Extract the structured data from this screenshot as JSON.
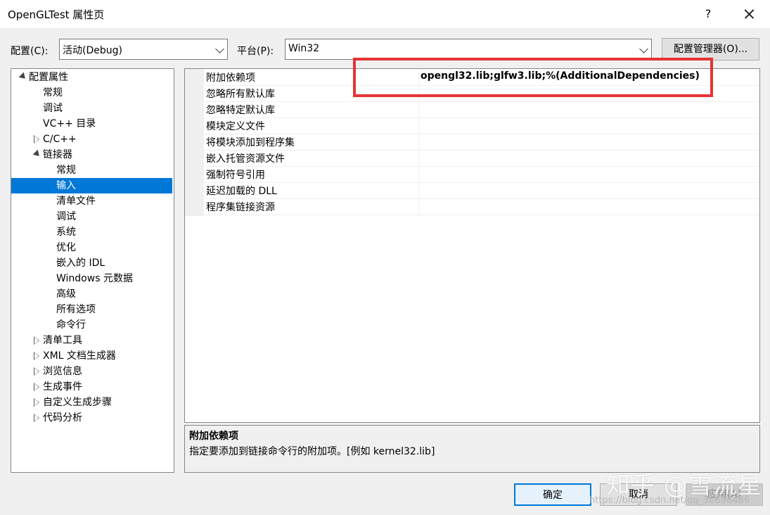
{
  "window": {
    "title": "OpenGLTest 属性页",
    "help": "?"
  },
  "config_row": {
    "config_label": "配置(C):",
    "config_value": "活动(Debug)",
    "platform_label": "平台(P):",
    "platform_value": "Win32",
    "manager_button": "配置管理器(O)..."
  },
  "tree": {
    "items": [
      {
        "label": "配置属性",
        "level": 0,
        "toggle": "expanded"
      },
      {
        "label": "常规",
        "level": 1,
        "toggle": "none"
      },
      {
        "label": "调试",
        "level": 1,
        "toggle": "none"
      },
      {
        "label": "VC++ 目录",
        "level": 1,
        "toggle": "none"
      },
      {
        "label": "C/C++",
        "level": 1,
        "toggle": "collapsed"
      },
      {
        "label": "链接器",
        "level": 1,
        "toggle": "expanded"
      },
      {
        "label": "常规",
        "level": 2,
        "toggle": "none"
      },
      {
        "label": "输入",
        "level": 2,
        "toggle": "none",
        "selected": true
      },
      {
        "label": "清单文件",
        "level": 2,
        "toggle": "none"
      },
      {
        "label": "调试",
        "level": 2,
        "toggle": "none"
      },
      {
        "label": "系统",
        "level": 2,
        "toggle": "none"
      },
      {
        "label": "优化",
        "level": 2,
        "toggle": "none"
      },
      {
        "label": "嵌入的 IDL",
        "level": 2,
        "toggle": "none"
      },
      {
        "label": "Windows 元数据",
        "level": 2,
        "toggle": "none"
      },
      {
        "label": "高级",
        "level": 2,
        "toggle": "none"
      },
      {
        "label": "所有选项",
        "level": 2,
        "toggle": "none"
      },
      {
        "label": "命令行",
        "level": 2,
        "toggle": "none"
      },
      {
        "label": "清单工具",
        "level": 1,
        "toggle": "collapsed"
      },
      {
        "label": "XML 文档生成器",
        "level": 1,
        "toggle": "collapsed"
      },
      {
        "label": "浏览信息",
        "level": 1,
        "toggle": "collapsed"
      },
      {
        "label": "生成事件",
        "level": 1,
        "toggle": "collapsed"
      },
      {
        "label": "自定义生成步骤",
        "level": 1,
        "toggle": "collapsed"
      },
      {
        "label": "代码分析",
        "level": 1,
        "toggle": "collapsed"
      }
    ]
  },
  "properties": [
    {
      "name": "附加依赖项",
      "value": "opengl32.lib;glfw3.lib;%(AdditionalDependencies)"
    },
    {
      "name": "忽略所有默认库",
      "value": ""
    },
    {
      "name": "忽略特定默认库",
      "value": ""
    },
    {
      "name": "模块定义文件",
      "value": ""
    },
    {
      "name": "将模块添加到程序集",
      "value": ""
    },
    {
      "name": "嵌入托管资源文件",
      "value": ""
    },
    {
      "name": "强制符号引用",
      "value": ""
    },
    {
      "name": "延迟加载的 DLL",
      "value": ""
    },
    {
      "name": "程序集链接资源",
      "value": ""
    }
  ],
  "description": {
    "title": "附加依赖项",
    "text": "指定要添加到链接命令行的附加项。[例如 kernel32.lib]"
  },
  "buttons": {
    "ok": "确定",
    "cancel": "取消",
    "apply": "应用(A)"
  },
  "watermark": {
    "line1": "知乎 @雪流星",
    "line2": "https://blog.csdn.net/qq_36696486"
  },
  "colors": {
    "selection": "#0078d7",
    "highlight_box": "#e53434"
  }
}
